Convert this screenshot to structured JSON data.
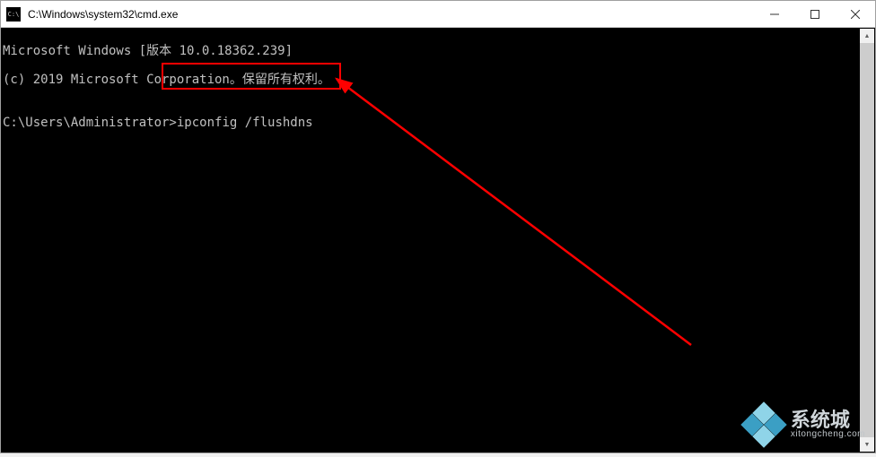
{
  "titlebar": {
    "icon_label": "C:\\",
    "title": "C:\\Windows\\system32\\cmd.exe"
  },
  "terminal": {
    "line1": "Microsoft Windows [版本 10.0.18362.239]",
    "line2": "(c) 2019 Microsoft Corporation。保留所有权利。",
    "blank": "",
    "prompt": "C:\\Users\\Administrator>",
    "command": "ipconfig /flushdns"
  },
  "annotation": {
    "highlight_color": "#ff0000"
  },
  "watermark": {
    "brand_cn": "系统城",
    "brand_en": "xitongcheng.com",
    "diamond_light": "#8fd4e8",
    "diamond_dark": "#3b9fc4"
  }
}
